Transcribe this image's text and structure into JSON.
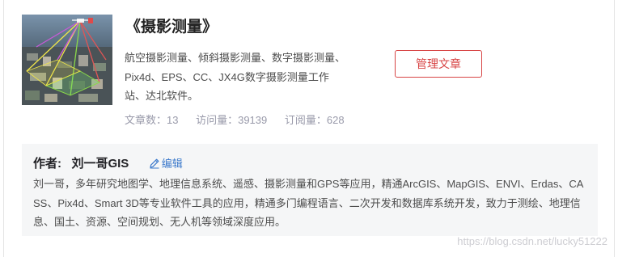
{
  "column": {
    "title": "《摄影测量》",
    "description": "航空摄影测量、倾斜摄影测量、数字摄影测量、Pix4d、EPS、CC、JX4G数字摄影测量工作站、达北软件。",
    "stats": {
      "articles_label": "文章数：13",
      "views_label": "访问量：39139",
      "subscriptions_label": "订阅量：628"
    },
    "manage_button_label": "管理文章"
  },
  "author": {
    "label": "作者:",
    "name": "刘一哥GIS",
    "edit_label": "编辑",
    "bio": "刘一哥，多年研究地图学、地理信息系统、遥感、摄影测量和GPS等应用，精通ArcGIS、MapGIS、ENVI、Erdas、CASS、Pix4d、Smart 3D等专业软件工具的应用，精通多门编程语言、二次开发和数据库系统开发，致力于测绘、地理信息、国土、资源、空间规划、无人机等领域深度应用。"
  },
  "watermark": "https://blog.csdn.net/lucky51222",
  "icons": {
    "edit": "pencil-icon"
  },
  "colors": {
    "accent_red": "#d74444",
    "link_blue": "#3d7acb",
    "muted_gray": "#999aaa",
    "panel_bg": "#f5f6f7"
  }
}
